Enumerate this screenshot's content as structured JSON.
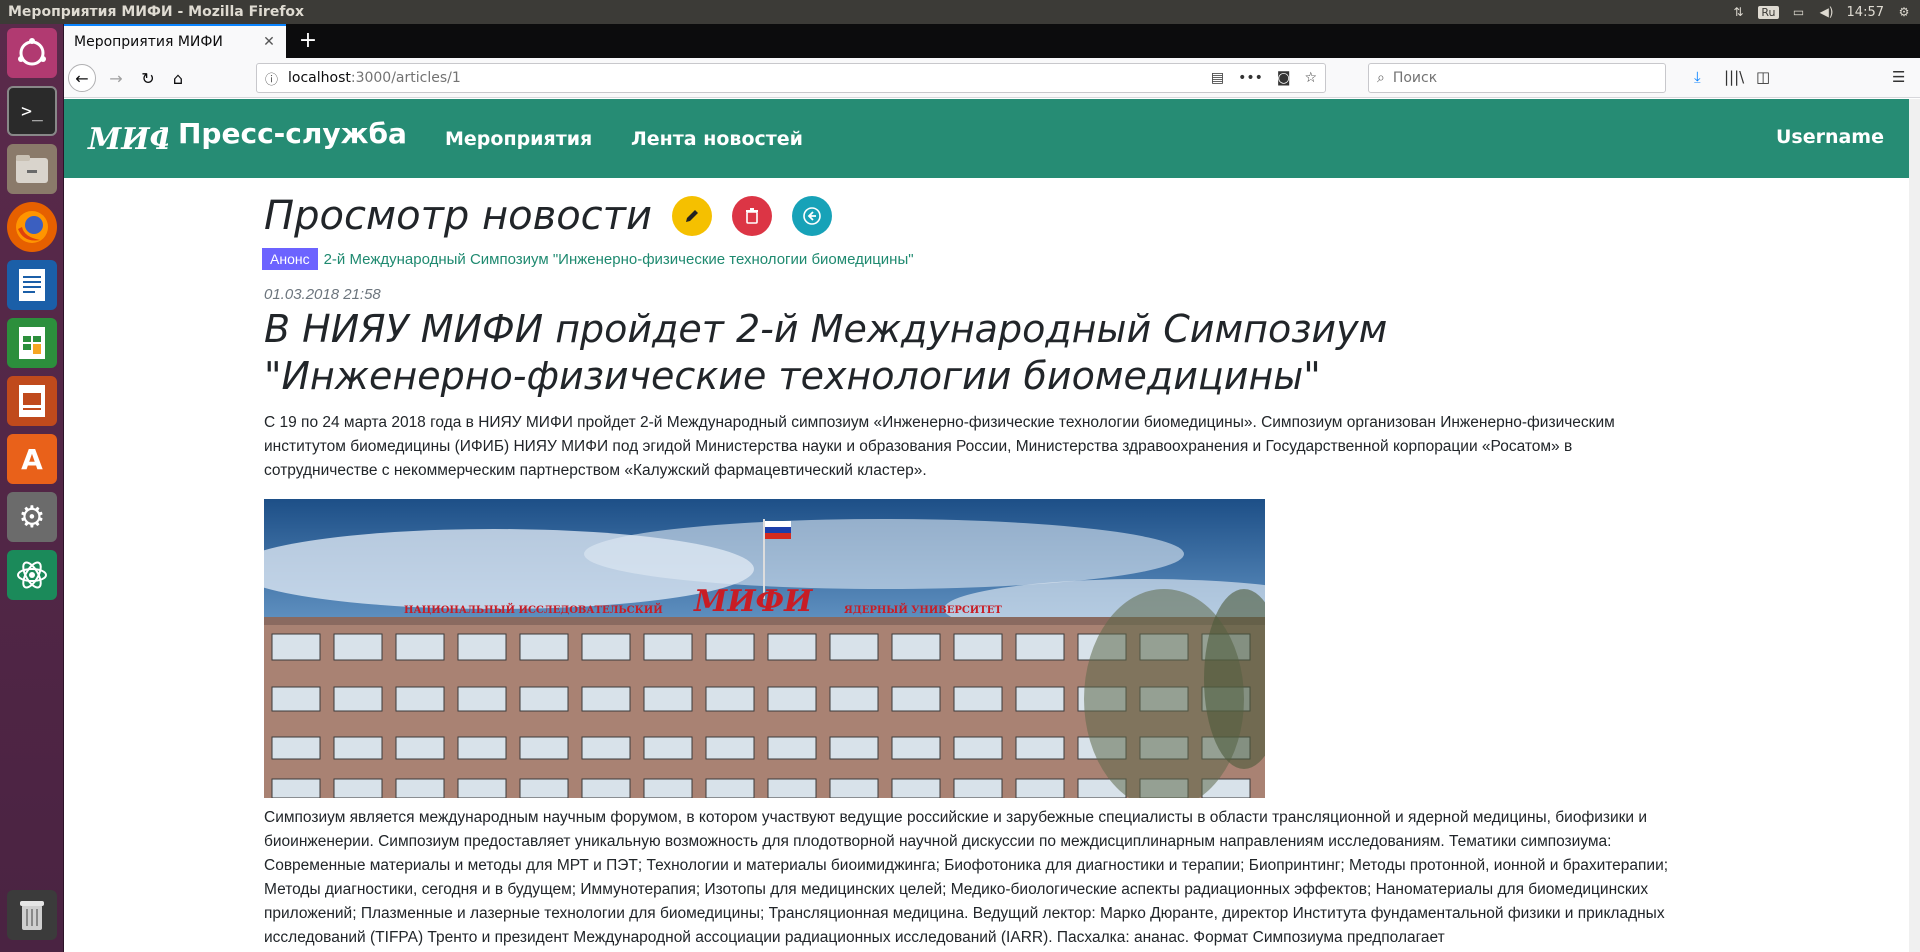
{
  "window": {
    "title": "Мероприятия МИФИ - Mozilla Firefox",
    "clock": "14:57",
    "keyboard_layout": "Ru"
  },
  "browser": {
    "tab_title": "Мероприятия МИФИ",
    "url_host": "localhost",
    "url_path": ":3000/articles/1",
    "search_placeholder": "Поиск"
  },
  "site": {
    "brand_name": "Пресс-служба",
    "brand_logo_text": "МИФИ",
    "nav_events": "Мероприятия",
    "nav_news": "Лента новостей",
    "username": "Username",
    "brand_color": "#268c74"
  },
  "page": {
    "heading": "Просмотр новости",
    "badge": "Анонс",
    "event_link": "2-й Международный Симпозиум \"Инженерно-физические технологии биомедицины\"",
    "date": "01.03.2018 21:58",
    "title": "В НИЯУ МИФИ пройдет 2-й Международный Симпозиум \"Инженерно-физические технологии биомедицины\"",
    "lead": "С 19 по 24 марта 2018 года в НИЯУ МИФИ пройдет 2-й Международный симпозиум «Инженерно-физические технологии биомедицины». Симпозиум организован Инженерно-физическим институтом биомедицины (ИФИБ) НИЯУ МИФИ под эгидой Министерства науки и образования России, Министерства здравоохранения и Государственной корпорации «Росатом» в сотрудничестве с некоммерческим партнерством «Калужский фармацевтический кластер».",
    "photo_sign_left": "НАЦИОНАЛЬНЫЙ ИССЛЕДОВАТЕЛЬСКИЙ",
    "photo_sign_logo": "МИФИ",
    "photo_sign_right": "ЯДЕРНЫЙ УНИВЕРСИТЕТ",
    "body": "Симпозиум является международным научным форумом, в котором участвуют ведущие российские и зарубежные специалисты в области трансляционной и ядерной медицины, биофизики и биоинженерии. Симпозиум предоставляет уникальную возможность для плодотворной научной дискуссии по междисциплинарным направлениям исследованиям. Тематики симпозиума: Современные материалы и методы для МРТ и ПЭТ; Технологии и материалы биоимиджинга; Биофотоника для диагностики и терапии; Биопринтинг; Методы протонной, ионной и брахитерапии; Методы диагностики, сегодня и в будущем; Иммунотерапия; Изотопы для медицинских целей; Медико-биологические аспекты радиационных эффектов; Наноматериалы для биомедицинских приложений; Плазменные и лазерные технологии для биомедицины; Трансляционная медицина. Ведущий лектор: Марко Дюранте, директор Института фундаментальной физики и прикладных исследований (TIFPA) Тренто и президент Международной ассоциации радиационных исследований (IARR). Пасхалка: ананас. Формат Симпозиума предполагает"
  }
}
